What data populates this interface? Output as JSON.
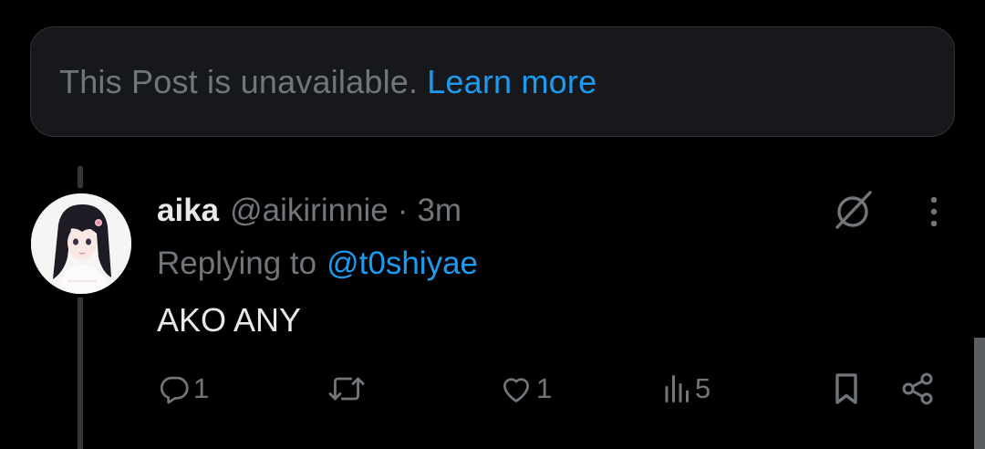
{
  "notice": {
    "text": "This Post is unavailable.",
    "link": "Learn more"
  },
  "reply": {
    "author_name": "aika",
    "author_handle": "@aikirinnie",
    "separator": "·",
    "time": "3m",
    "replying_label": "Replying to",
    "replying_to": "@t0shiyae",
    "text": "AKO ANY"
  },
  "actions": {
    "replies": "1",
    "reposts": "",
    "likes": "1",
    "views": "5"
  },
  "icons": {
    "top_right": [
      "grok-slash-icon",
      "more-vertical-icon"
    ],
    "actions": [
      "reply-icon",
      "repost-icon",
      "like-icon",
      "views-icon",
      "bookmark-icon",
      "share-icon"
    ]
  },
  "colors": {
    "background": "#000000",
    "notice_bg": "#16181c",
    "muted": "#71767b",
    "link": "#1d9bf0",
    "text": "#e7e9ea"
  }
}
